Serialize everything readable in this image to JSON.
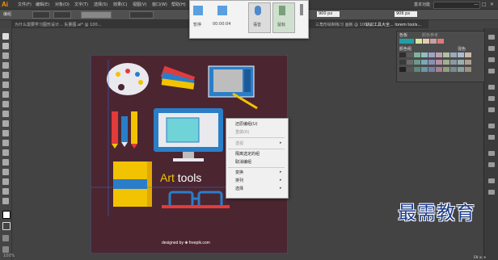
{
  "app": {
    "logo": "Ai"
  },
  "menubar": {
    "items": [
      "文件(F)",
      "编辑(E)",
      "对象(O)",
      "文字(T)",
      "选择(S)",
      "效果(C)",
      "视图(V)",
      "窗口(W)",
      "帮助(H)"
    ],
    "workspace": "基本功能",
    "window_controls": [
      "—",
      "□",
      "✕"
    ]
  },
  "controlbar": {
    "label": "编组",
    "width_value": "900 px",
    "height_value": "906 px"
  },
  "tabs": [
    {
      "label": "为什么需要学习图形设计... 矢量图.ai* @ 100..."
    },
    {
      "label": "三角形绘制练习 画板 @ 100%..."
    },
    {
      "label": "认识工具大全... lorem tools..."
    }
  ],
  "recorder": {
    "items": [
      {
        "label": "暂停",
        "icon": "pause-icon"
      },
      {
        "label": "00:00:04",
        "icon": "timer-icon"
      },
      {
        "label": "语音",
        "icon": "mic-icon"
      },
      {
        "label": "鼠标",
        "icon": "cursor-icon"
      },
      {
        "label": "",
        "icon": "more-icon"
      }
    ]
  },
  "artwork": {
    "word1": "Art",
    "word2": "tools",
    "credit": "designed by ❀ freepik.com"
  },
  "context_menu": {
    "items": [
      {
        "label": "还原编组(U)",
        "disabled": false,
        "submenu": false
      },
      {
        "label": "重做(R)",
        "disabled": true,
        "submenu": false
      },
      {
        "label": "透视",
        "disabled": true,
        "submenu": true
      },
      {
        "label": "隔离选定的组",
        "disabled": false,
        "submenu": false
      },
      {
        "label": "取消编组",
        "disabled": false,
        "submenu": false
      },
      {
        "label": "变换",
        "disabled": false,
        "submenu": true
      },
      {
        "label": "排列",
        "disabled": false,
        "submenu": true
      },
      {
        "label": "选择",
        "disabled": false,
        "submenu": true
      }
    ]
  },
  "swatches_panel": {
    "tab1": "色板",
    "tab2": "颜色参考",
    "name_label": "颜色组",
    "type_label": "混色"
  },
  "status": {
    "zoom": "100%"
  },
  "watermark": "最需教育",
  "tray": "EN ⊕ ◔"
}
